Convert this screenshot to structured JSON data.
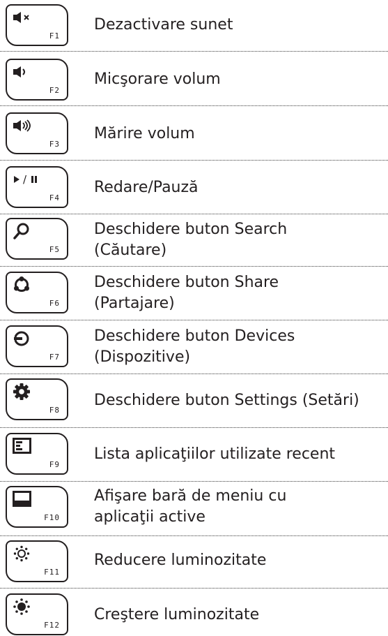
{
  "rows": [
    {
      "key": "F1",
      "icon": "mute-icon",
      "lines": [
        "Dezactivare sunet"
      ]
    },
    {
      "key": "F2",
      "icon": "volume-down-icon",
      "lines": [
        "Micşorare volum"
      ]
    },
    {
      "key": "F3",
      "icon": "volume-up-icon",
      "lines": [
        "Mărire volum"
      ]
    },
    {
      "key": "F4",
      "icon": "play-pause-icon",
      "lines": [
        "Redare/Pauză"
      ]
    },
    {
      "key": "F5",
      "icon": "search-icon",
      "lines": [
        "Deschidere buton Search",
        "(Căutare)"
      ]
    },
    {
      "key": "F6",
      "icon": "share-icon",
      "lines": [
        "Deschidere buton Share",
        "(Partajare)"
      ]
    },
    {
      "key": "F7",
      "icon": "devices-icon",
      "lines": [
        "Deschidere buton Devices",
        "(Dispozitive)"
      ]
    },
    {
      "key": "F8",
      "icon": "settings-gear-icon",
      "lines": [
        "Deschidere buton Settings (Setări)"
      ]
    },
    {
      "key": "F9",
      "icon": "recent-apps-icon",
      "lines": [
        "Lista aplicaţiilor utilizate recent"
      ]
    },
    {
      "key": "F10",
      "icon": "app-bar-icon",
      "lines": [
        "Afişare bară de meniu cu",
        "aplicaţii active"
      ]
    },
    {
      "key": "F11",
      "icon": "brightness-down-icon",
      "lines": [
        "Reducere luminozitate"
      ]
    },
    {
      "key": "F12",
      "icon": "brightness-up-icon",
      "lines": [
        "Creştere luminozitate"
      ]
    }
  ],
  "play_pause_slash": "/"
}
